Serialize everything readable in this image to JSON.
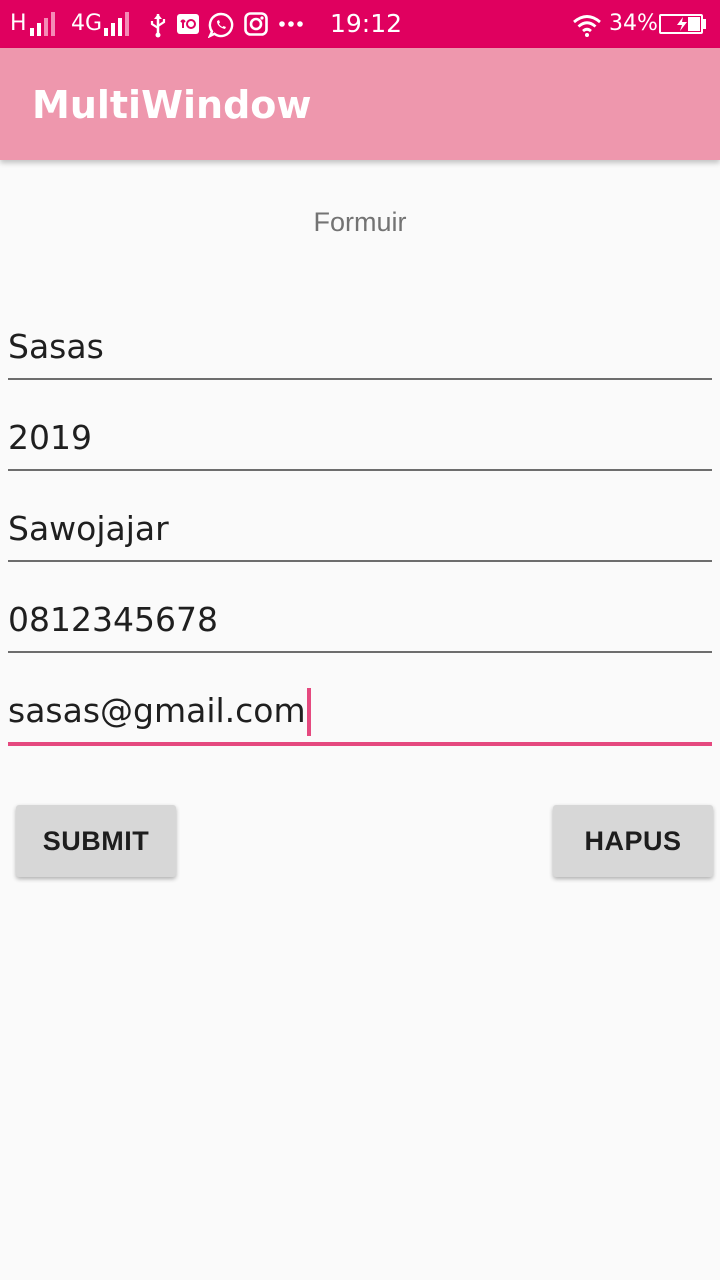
{
  "status_bar": {
    "network_h": "H",
    "network_4g": "4G",
    "notification_icons": [
      "usb-icon",
      "usb-debug-icon",
      "whatsapp-icon",
      "instagram-icon",
      "more-icon"
    ],
    "time": "19:12",
    "battery_percent": "34%",
    "battery_level": 0.34,
    "background_color": "#e0005f"
  },
  "app_bar": {
    "title": "MultiWindow",
    "background_color": "#ee97ad"
  },
  "form": {
    "heading": "Formuir",
    "fields": [
      {
        "value": "Sasas"
      },
      {
        "value": "2019"
      },
      {
        "value": "Sawojajar"
      },
      {
        "value": "0812345678"
      },
      {
        "value": "sasas@gmail.com",
        "focused": true
      }
    ],
    "accent_color": "#e5497f"
  },
  "buttons": {
    "submit_label": "SUBMIT",
    "hapus_label": "HAPUS"
  }
}
